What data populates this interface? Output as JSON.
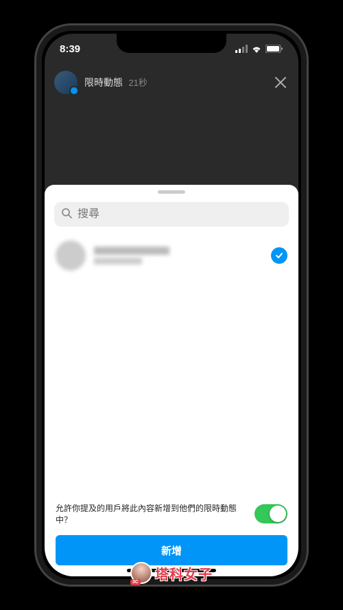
{
  "status": {
    "time": "8:39"
  },
  "story": {
    "title": "限時動態",
    "duration": "21秒"
  },
  "search": {
    "placeholder": "搜尋"
  },
  "users": [
    {
      "selected": true
    }
  ],
  "permission": {
    "label": "允許你提及的用戶將此內容新增到他們的限時動態中？",
    "enabled": true
  },
  "actions": {
    "add_label": "新增"
  },
  "watermark": {
    "text": "塔科女子"
  }
}
